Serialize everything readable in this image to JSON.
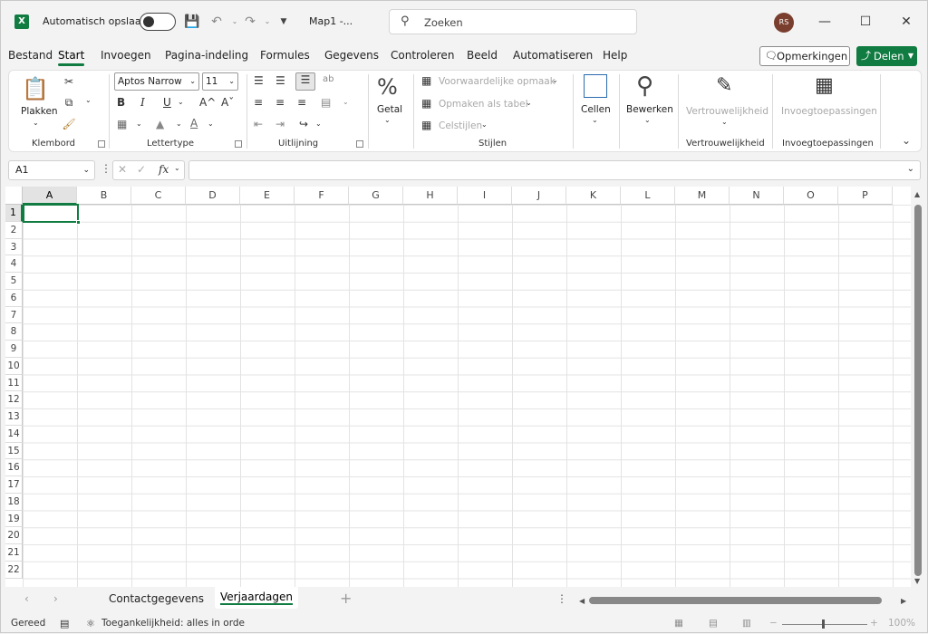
{
  "titlebar": {
    "app_icon": "X",
    "autosave_label": "Automatisch opslaan",
    "autosave_on": false,
    "doc_title": "Map1  -...",
    "search_placeholder": "Zoeken",
    "avatar_initials": "RS",
    "controls": [
      "minimize",
      "maximize",
      "close"
    ]
  },
  "menu": {
    "items": [
      "Bestand",
      "Start",
      "Invoegen",
      "Pagina-indeling",
      "Formules",
      "Gegevens",
      "Controleren",
      "Beeld",
      "Automatiseren",
      "Help"
    ],
    "active": "Start",
    "comments_label": "Opmerkingen",
    "share_label": "Delen"
  },
  "ribbon": {
    "clipboard": {
      "paste_label": "Plakken",
      "group_label": "Klembord"
    },
    "font": {
      "font_name": "Aptos Narrow",
      "font_size": "11",
      "bold": "B",
      "italic": "I",
      "underline": "U",
      "grow": "A^",
      "shrink": "Aˇ",
      "font_color_letter": "A",
      "group_label": "Lettertype"
    },
    "alignment": {
      "group_label": "Uitlijning"
    },
    "number": {
      "label": "Getal",
      "icon_glyph": "%"
    },
    "styles": {
      "conditional": "Voorwaardelijke opmaak",
      "as_table": "Opmaken als tabel",
      "cell_styles": "Celstijlen",
      "group_label": "Stijlen"
    },
    "cells": {
      "label": "Cellen"
    },
    "editing": {
      "label": "Bewerken"
    },
    "sensitivity": {
      "label": "Vertrouwelijkheid",
      "group_label": "Vertrouwelijkheid"
    },
    "addins": {
      "label": "Invoegtoepassingen",
      "group_label": "Invoegtoepassingen"
    }
  },
  "formula_bar": {
    "name_box": "A1",
    "fx_label": "fx",
    "formula": ""
  },
  "grid": {
    "columns": [
      "A",
      "B",
      "C",
      "D",
      "E",
      "F",
      "G",
      "H",
      "I",
      "J",
      "K",
      "L",
      "M",
      "N",
      "O",
      "P"
    ],
    "rows": [
      "1",
      "2",
      "3",
      "4",
      "5",
      "6",
      "7",
      "8",
      "9",
      "10",
      "11",
      "12",
      "13",
      "14",
      "15",
      "16",
      "17",
      "18",
      "19",
      "20",
      "21",
      "22"
    ],
    "active_cell": "A1"
  },
  "sheets": {
    "tabs": [
      "Contactgegevens",
      "Verjaardagen"
    ],
    "active": "Verjaardagen",
    "add_label": "+"
  },
  "status": {
    "ready": "Gereed",
    "accessibility": "Toegankelijkheid: alles in orde",
    "zoom": "100%"
  },
  "colors": {
    "accent": "#107c41",
    "avatar": "#7a3e2e"
  }
}
